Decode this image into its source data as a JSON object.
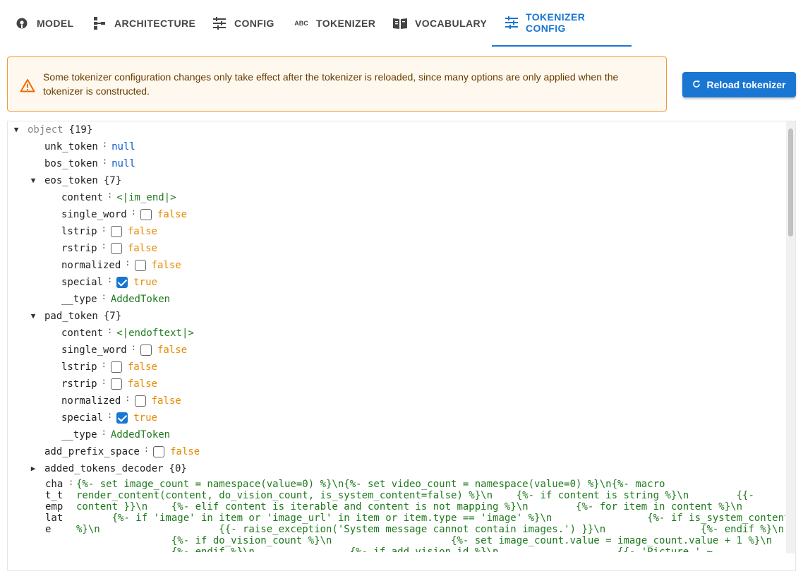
{
  "tabs": [
    {
      "label": "MODEL",
      "icon": "model-icon"
    },
    {
      "label": "ARCHITECTURE",
      "icon": "architecture-icon"
    },
    {
      "label": "CONFIG",
      "icon": "sliders-icon"
    },
    {
      "label": "TOKENIZER",
      "icon": "abc-icon"
    },
    {
      "label": "VOCABULARY",
      "icon": "book-icon"
    },
    {
      "label": "TOKENIZER CONFIG",
      "icon": "sliders-icon",
      "active": true
    }
  ],
  "alert": {
    "message": "Some tokenizer configuration changes only take effect after the tokenizer is reloaded, since many options are only applied when the tokenizer is constructed."
  },
  "reload_button": "Reload tokenizer",
  "tree": {
    "root_label": "object",
    "root_count": "{19}",
    "unk_token": {
      "key": "unk_token",
      "value": "null"
    },
    "bos_token": {
      "key": "bos_token",
      "value": "null"
    },
    "eos_token": {
      "key": "eos_token",
      "count": "{7}",
      "content": "<|im_end|>",
      "single_word": "false",
      "lstrip": "false",
      "rstrip": "false",
      "normalized": "false",
      "special": "true",
      "type": "AddedToken"
    },
    "pad_token": {
      "key": "pad_token",
      "count": "{7}",
      "content": "<|endoftext|>",
      "single_word": "false",
      "lstrip": "false",
      "rstrip": "false",
      "normalized": "false",
      "special": "true",
      "type": "AddedToken"
    },
    "add_prefix_space": "false",
    "added_tokens_decoder": {
      "key": "added_tokens_decoder",
      "count": "{0}"
    },
    "field_labels": {
      "content": "content",
      "single_word": "single_word",
      "lstrip": "lstrip",
      "rstrip": "rstrip",
      "normalized": "normalized",
      "special": "special",
      "type": "__type",
      "add_prefix_space": "add_prefix_space"
    },
    "chat_template_key": "cha\nt_t\nemp\nlat\ne",
    "chat_template_value": "{%- set image_count = namespace(value=0) %}\\n{%- set video_count = namespace(value=0) %}\\n{%- macro\nrender_content(content, do_vision_count, is_system_content=false) %}\\n    {%- if content is string %}\\n        {{-\ncontent }}\\n    {%- elif content is iterable and content is not mapping %}\\n        {%- for item in content %}\\n\n      {%- if 'image' in item or 'image_url' in item or item.type == 'image' %}\\n                {%- if is_system_content\n%}\\n                    {{- raise_exception('System message cannot contain images.') }}\\n                {%- endif %}\\n\n                {%- if do_vision_count %}\\n                    {%- set image_count.value = image_count.value + 1 %}\\n\n                {%- endif %}\\n                {%- if add_vision_id %}\\n                    {{- 'Picture ' ~"
  }
}
